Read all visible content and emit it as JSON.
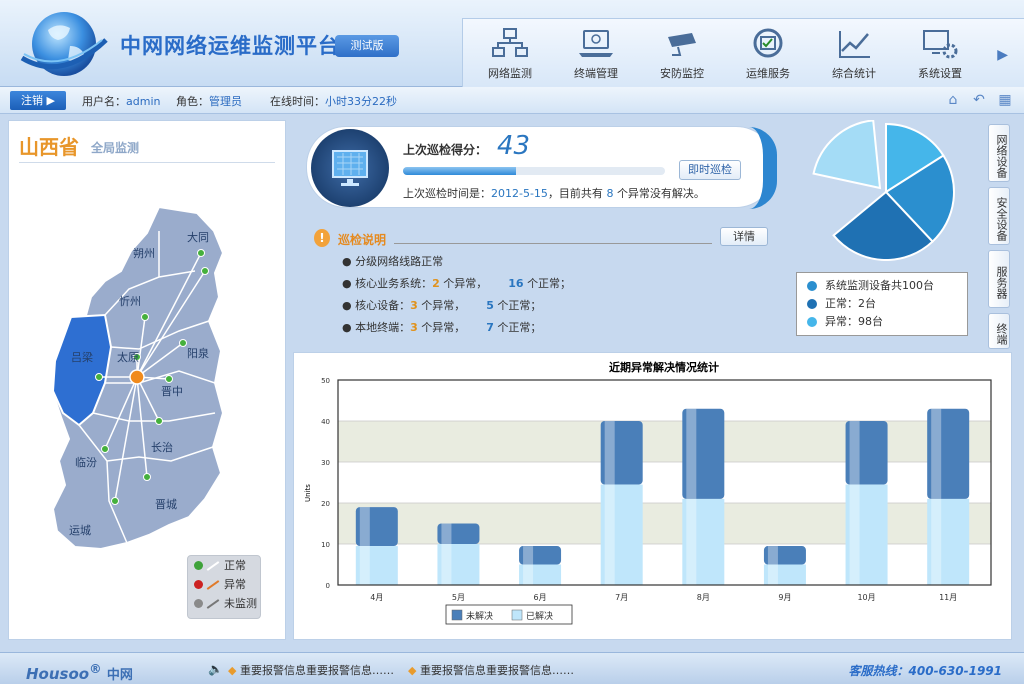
{
  "header": {
    "title": "中网网络运维监测平台",
    "badge": "测试版"
  },
  "nav": [
    {
      "label": "网络监测",
      "icon": "network-icon"
    },
    {
      "label": "终端管理",
      "icon": "laptop-icon"
    },
    {
      "label": "安防监控",
      "icon": "camera-icon"
    },
    {
      "label": "运维服务",
      "icon": "service-icon"
    },
    {
      "label": "综合统计",
      "icon": "chart-icon"
    },
    {
      "label": "系统设置",
      "icon": "settings-icon"
    }
  ],
  "infobar": {
    "logout": "注销",
    "username_label": "用户名：",
    "username": "admin",
    "role_label": "角色：",
    "role": "管理员",
    "online_label": "在线时间：",
    "online": "小时33分22秒"
  },
  "map": {
    "province": "山西省",
    "subtitle": "全局监测",
    "cities": [
      "大同",
      "朔州",
      "忻州",
      "阳泉",
      "太原",
      "吕梁",
      "晋中",
      "长治",
      "临汾",
      "晋城",
      "运城"
    ],
    "legend": [
      {
        "label": "正常",
        "color": "#3ea23a"
      },
      {
        "label": "异常",
        "color": "#cc2222"
      },
      {
        "label": "未监测",
        "color": "#8a8a8a"
      }
    ]
  },
  "score": {
    "label": "上次巡检得分：",
    "value": "43",
    "progress": 0.43,
    "button": "即时巡检",
    "date_prefix": "上次巡检时间是：",
    "date": "2012-5-15",
    "mid": "，目前共有",
    "count": "8",
    "suffix": "个异常没有解决。"
  },
  "inspection": {
    "title": "巡检说明",
    "detail_button": "详情",
    "items": [
      {
        "text": "分级网络线路正常"
      },
      {
        "prefix": "核心业务系统：",
        "abnormal": "2",
        "abnormal_unit": "个异常，",
        "normal": "16",
        "normal_unit": "个正常；"
      },
      {
        "prefix": "核心设备：",
        "abnormal": "3",
        "abnormal_unit": "个异常，",
        "normal": "5",
        "normal_unit": "个正常；"
      },
      {
        "prefix": "本地终端：",
        "abnormal": "3",
        "abnormal_unit": "个异常，",
        "normal": "7",
        "normal_unit": "个正常；"
      }
    ]
  },
  "device_stats": {
    "total": "系统监测设备共100台",
    "normal": "正常：2台",
    "abnormal": "异常：98台"
  },
  "side_tabs": [
    "网络设备",
    "安全设备",
    "服务器",
    "终端"
  ],
  "chart_data": {
    "type": "bar",
    "title": "近期异常解决情况统计",
    "ylabel": "Units",
    "ylim": [
      0,
      50
    ],
    "categories": [
      "4月",
      "5月",
      "6月",
      "7月",
      "8月",
      "9月",
      "10月",
      "11月"
    ],
    "series": [
      {
        "name": "未解决",
        "values": [
          9.5,
          5,
          4.5,
          15.5,
          22,
          4.5,
          15.5,
          22
        ],
        "color": "#4a7fb9"
      },
      {
        "name": "已解决",
        "values": [
          9.5,
          10,
          5,
          24.5,
          21,
          5,
          24.5,
          21
        ],
        "color": "#bfe6fb"
      }
    ],
    "stacked": true,
    "legend": "bottom-center",
    "grid": true
  },
  "pie_data": {
    "slices": [
      {
        "value": 0.16,
        "color": "#45b6ea"
      },
      {
        "value": 0.22,
        "color": "#2b8fcf"
      },
      {
        "value": 0.26,
        "color": "#1f71b3"
      },
      {
        "value": 0.36,
        "color": "#1a87c9"
      }
    ],
    "exploded": {
      "value": 0.2,
      "color": "#a4dcf6"
    }
  },
  "footer": {
    "logo": "Housoo",
    "logo_cn": "中网",
    "alerts": [
      "重要报警信息重要报警信息……",
      "重要报警信息重要报警信息……"
    ],
    "hotline": "客服热线：400-630-1991"
  }
}
